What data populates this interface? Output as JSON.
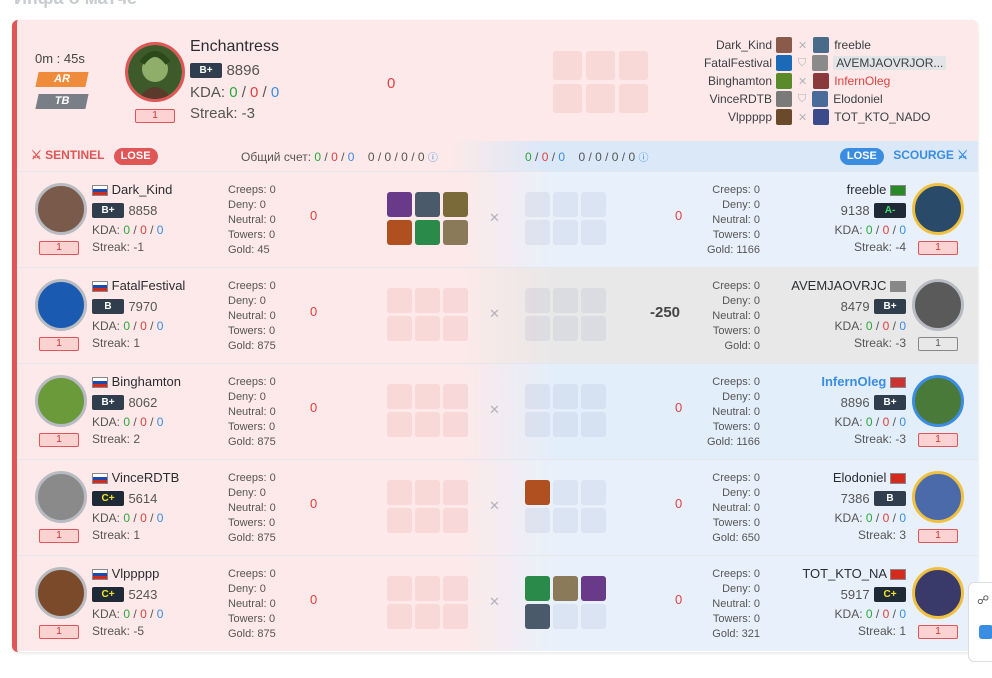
{
  "page_title": "Инфа о матче",
  "match": {
    "duration": "0m : 45s",
    "mode1": "AR",
    "mode2": "TB"
  },
  "mvp": {
    "name": "Enchantress",
    "rank": "B+",
    "score": "8896",
    "kda_label": "KDA:",
    "k": "0",
    "d": "0",
    "a": "0",
    "streak": "Streak: -3",
    "level": "1",
    "gold_diff": "0"
  },
  "lineup": {
    "left": [
      "Dark_Kind",
      "FatalFestival",
      "Binghamton",
      "VinceRDTB",
      "Vlppppp"
    ],
    "right": [
      "freeble",
      "AVEMJAOVRJOR...",
      "InfernOleg",
      "Elodoniel",
      "TOT_KTO_NADO"
    ]
  },
  "sentinel": {
    "label": "SENTINEL",
    "result": "LOSE",
    "total_label": "Общий счет:",
    "k": "0",
    "d": "0",
    "a": "0",
    "extra": "0 / 0 / 0 / 0"
  },
  "scourge": {
    "label": "SCOURGE",
    "result": "LOSE",
    "k": "0",
    "d": "0",
    "a": "0",
    "extra": "0 / 0 / 0 / 0"
  },
  "rows": [
    {
      "left": {
        "name": "Dark_Kind",
        "rank": "B+",
        "score": "8858",
        "k": "0",
        "d": "0",
        "a": "0",
        "streak": "Streak: -1",
        "level": "1",
        "stats": [
          "Creeps: 0",
          "Deny: 0",
          "Neutral: 0",
          "Towers: 0",
          "Gold: 45"
        ],
        "diff": "0"
      },
      "right": {
        "name": "freeble",
        "rank": "A-",
        "score": "9138",
        "k": "0",
        "d": "0",
        "a": "0",
        "streak": "Streak: -4",
        "level": "1",
        "stats": [
          "Creeps: 0",
          "Deny: 0",
          "Neutral: 0",
          "Towers: 0",
          "Gold: 1166"
        ],
        "diff": "0"
      }
    },
    {
      "left": {
        "name": "FatalFestival",
        "rank": "B",
        "score": "7970",
        "k": "0",
        "d": "0",
        "a": "0",
        "streak": "Streak: 1",
        "level": "1",
        "stats": [
          "Creeps: 0",
          "Deny: 0",
          "Neutral: 0",
          "Towers: 0",
          "Gold: 875"
        ],
        "diff": "0"
      },
      "right": {
        "name": "AVEMJAOVRJC",
        "rank": "B+",
        "score": "8479",
        "k": "0",
        "d": "0",
        "a": "0",
        "streak": "Streak: -3",
        "level": "1",
        "stats": [
          "Creeps: 0",
          "Deny: 0",
          "Neutral: 0",
          "Towers: 0",
          "Gold: 0"
        ],
        "diff": "-250"
      }
    },
    {
      "left": {
        "name": "Binghamton",
        "rank": "B+",
        "score": "8062",
        "k": "0",
        "d": "0",
        "a": "0",
        "streak": "Streak: 2",
        "level": "1",
        "stats": [
          "Creeps: 0",
          "Deny: 0",
          "Neutral: 0",
          "Towers: 0",
          "Gold: 875"
        ],
        "diff": "0"
      },
      "right": {
        "name": "InfernOleg",
        "rank": "B+",
        "score": "8896",
        "k": "0",
        "d": "0",
        "a": "0",
        "streak": "Streak: -3",
        "level": "1",
        "stats": [
          "Creeps: 0",
          "Deny: 0",
          "Neutral: 0",
          "Towers: 0",
          "Gold: 1166"
        ],
        "diff": "0"
      }
    },
    {
      "left": {
        "name": "VinceRDTB",
        "rank": "C+",
        "score": "5614",
        "k": "0",
        "d": "0",
        "a": "0",
        "streak": "Streak: 1",
        "level": "1",
        "stats": [
          "Creeps: 0",
          "Deny: 0",
          "Neutral: 0",
          "Towers: 0",
          "Gold: 875"
        ],
        "diff": "0"
      },
      "right": {
        "name": "Elodoniel",
        "rank": "B",
        "score": "7386",
        "k": "0",
        "d": "0",
        "a": "0",
        "streak": "Streak: 3",
        "level": "1",
        "stats": [
          "Creeps: 0",
          "Deny: 0",
          "Neutral: 0",
          "Towers: 0",
          "Gold: 650"
        ],
        "diff": "0"
      }
    },
    {
      "left": {
        "name": "Vlppppp",
        "rank": "C+",
        "score": "5243",
        "k": "0",
        "d": "0",
        "a": "0",
        "streak": "Streak: -5",
        "level": "1",
        "stats": [
          "Creeps: 0",
          "Deny: 0",
          "Neutral: 0",
          "Towers: 0",
          "Gold: 875"
        ],
        "diff": "0"
      },
      "right": {
        "name": "TOT_KTO_NA",
        "rank": "C+",
        "score": "5917",
        "k": "0",
        "d": "0",
        "a": "0",
        "streak": "Streak: 1",
        "level": "1",
        "stats": [
          "Creeps: 0",
          "Deny: 0",
          "Neutral: 0",
          "Towers: 0",
          "Gold: 321"
        ],
        "diff": "0"
      }
    }
  ],
  "labels": {
    "kda": "KDA:"
  },
  "colors": {
    "sentinel": "#e05555",
    "scourge": "#3a8de0",
    "lose_red": "#e05555",
    "lose_blue": "#3a8de0"
  }
}
